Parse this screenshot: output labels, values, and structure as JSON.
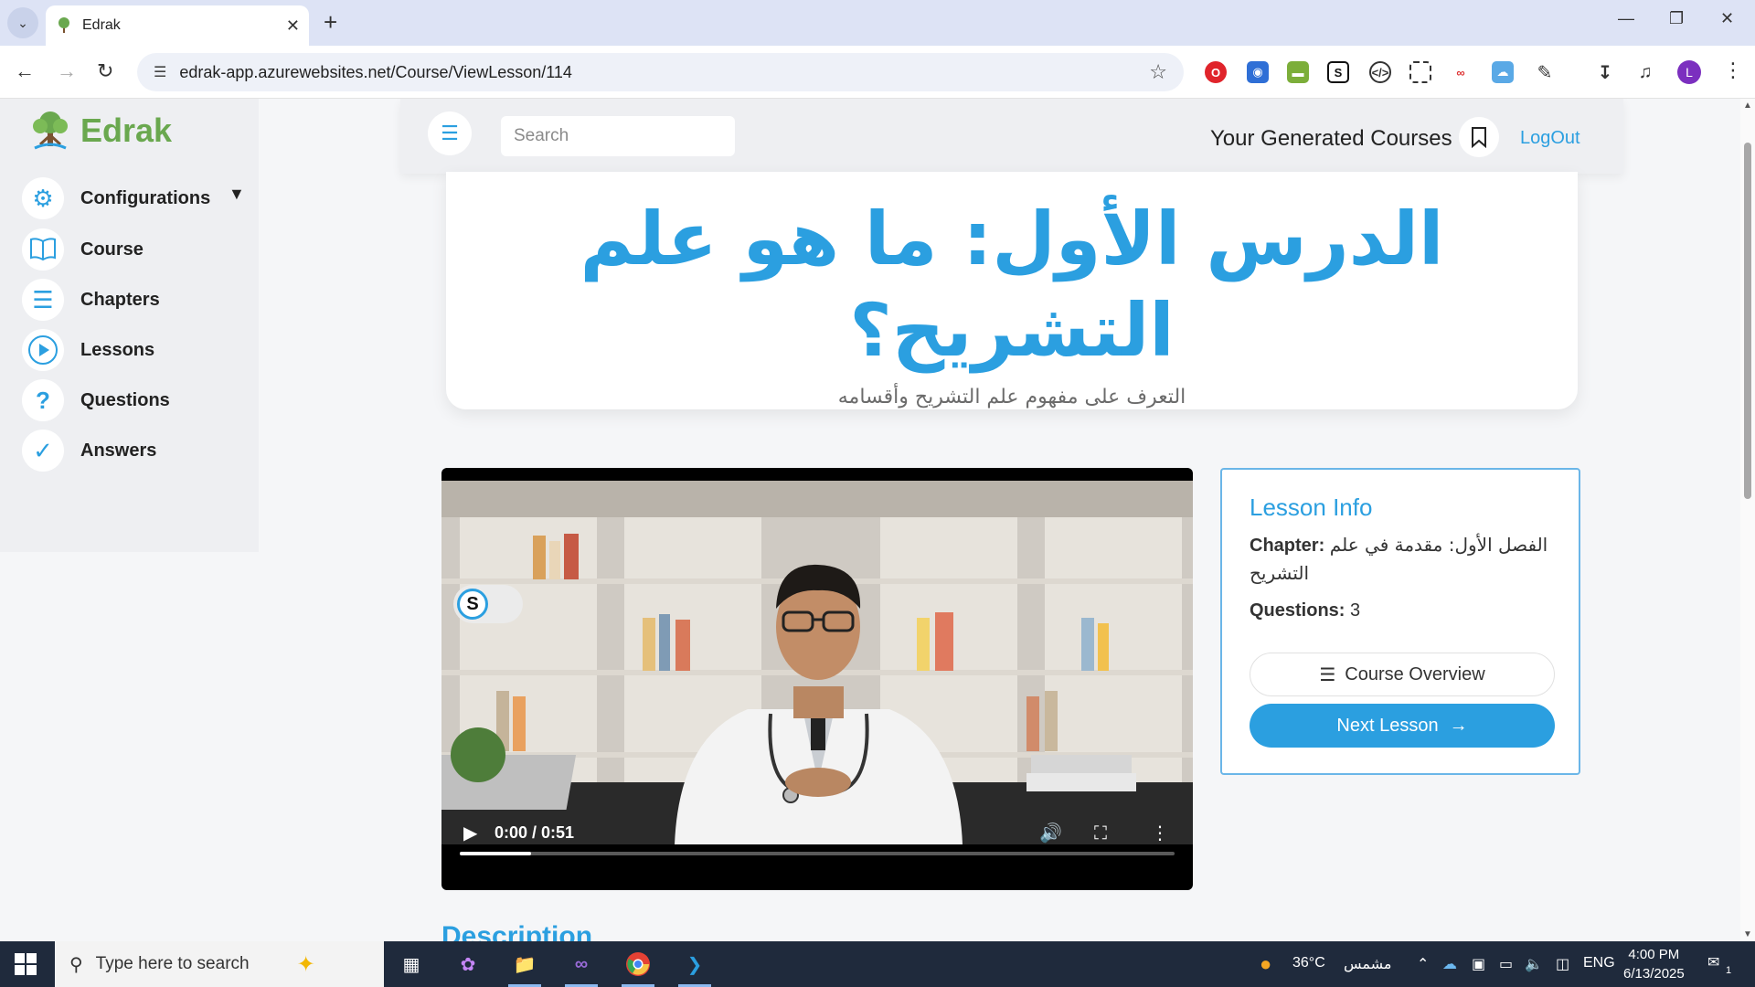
{
  "browser": {
    "tab_title": "Edrak",
    "url": "edrak-app.azurewebsites.net/Course/ViewLesson/114"
  },
  "brand": {
    "name": "Edrak"
  },
  "sidebar": {
    "items": [
      {
        "label": "Configurations",
        "icon": "gear-icon"
      },
      {
        "label": "Course",
        "icon": "book-icon"
      },
      {
        "label": "Chapters",
        "icon": "list-icon"
      },
      {
        "label": "Lessons",
        "icon": "play-circle-icon"
      },
      {
        "label": "Questions",
        "icon": "question-icon"
      },
      {
        "label": "Answers",
        "icon": "check-icon"
      }
    ]
  },
  "topbar": {
    "search_placeholder": "Search",
    "generated_courses": "Your Generated Courses",
    "logout": "LogOut"
  },
  "lesson": {
    "title": "الدرس الأول: ما هو علم التشريح؟",
    "subtitle": "التعرف على مفهوم علم التشريح وأقسامه"
  },
  "video": {
    "time": "0:00 / 0:51",
    "ext_badge": "S",
    "progress": 0.1
  },
  "info": {
    "heading": "Lesson Info",
    "chapter_label": "Chapter:",
    "chapter_value": "الفصل الأول: مقدمة في علم التشريح",
    "questions_label": "Questions:",
    "questions_value": "3",
    "overview_button": "Course Overview",
    "next_button": "Next Lesson"
  },
  "description_heading": "Description",
  "taskbar": {
    "search_placeholder": "Type here to search",
    "weather_temp": "36°C",
    "weather_text": "مشمس",
    "language": "ENG",
    "time": "4:00 PM",
    "date": "6/13/2025",
    "notifications": "1"
  },
  "colors": {
    "accent": "#2b9fe0",
    "brand_green": "#6aa84f"
  }
}
